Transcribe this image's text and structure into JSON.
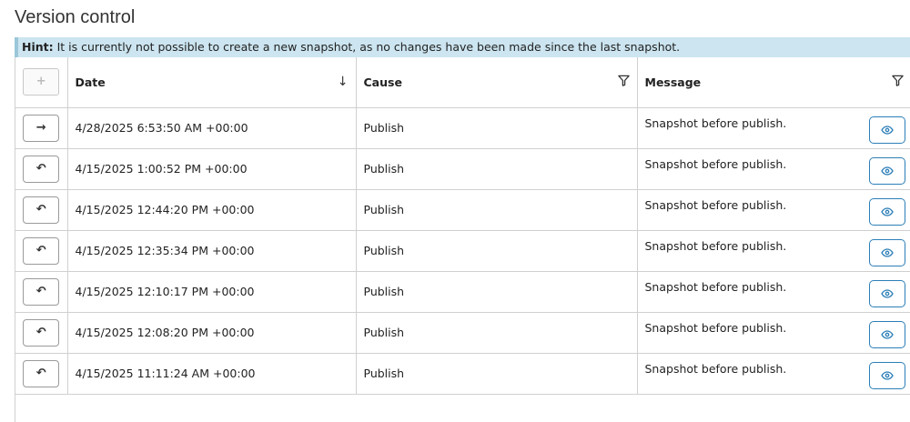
{
  "page": {
    "title": "Version control"
  },
  "hint": {
    "label": "Hint:",
    "text": " It is currently not possible to create a new snapshot, as no changes have been made since the last snapshot."
  },
  "table": {
    "add_icon": "+",
    "columns": {
      "date": "Date",
      "cause": "Cause",
      "message": "Message"
    },
    "rows": [
      {
        "action_icon": "arrow-right-icon",
        "action_glyph": "→",
        "date": "4/28/2025 6:53:50 AM +00:00",
        "cause": "Publish",
        "message": "Snapshot before publish."
      },
      {
        "action_icon": "undo-icon",
        "action_glyph": "↶",
        "date": "4/15/2025 1:00:52 PM +00:00",
        "cause": "Publish",
        "message": "Snapshot before publish."
      },
      {
        "action_icon": "undo-icon",
        "action_glyph": "↶",
        "date": "4/15/2025 12:44:20 PM +00:00",
        "cause": "Publish",
        "message": "Snapshot before publish."
      },
      {
        "action_icon": "undo-icon",
        "action_glyph": "↶",
        "date": "4/15/2025 12:35:34 PM +00:00",
        "cause": "Publish",
        "message": "Snapshot before publish."
      },
      {
        "action_icon": "undo-icon",
        "action_glyph": "↶",
        "date": "4/15/2025 12:10:17 PM +00:00",
        "cause": "Publish",
        "message": "Snapshot before publish."
      },
      {
        "action_icon": "undo-icon",
        "action_glyph": "↶",
        "date": "4/15/2025 12:08:20 PM +00:00",
        "cause": "Publish",
        "message": "Snapshot before publish."
      },
      {
        "action_icon": "undo-icon",
        "action_glyph": "↶",
        "date": "4/15/2025 11:11:24 AM +00:00",
        "cause": "Publish",
        "message": "Snapshot before publish."
      }
    ]
  },
  "colors": {
    "hint_bg": "#cce5f0",
    "accent": "#2c7fb8",
    "border": "#d0d0d0"
  }
}
